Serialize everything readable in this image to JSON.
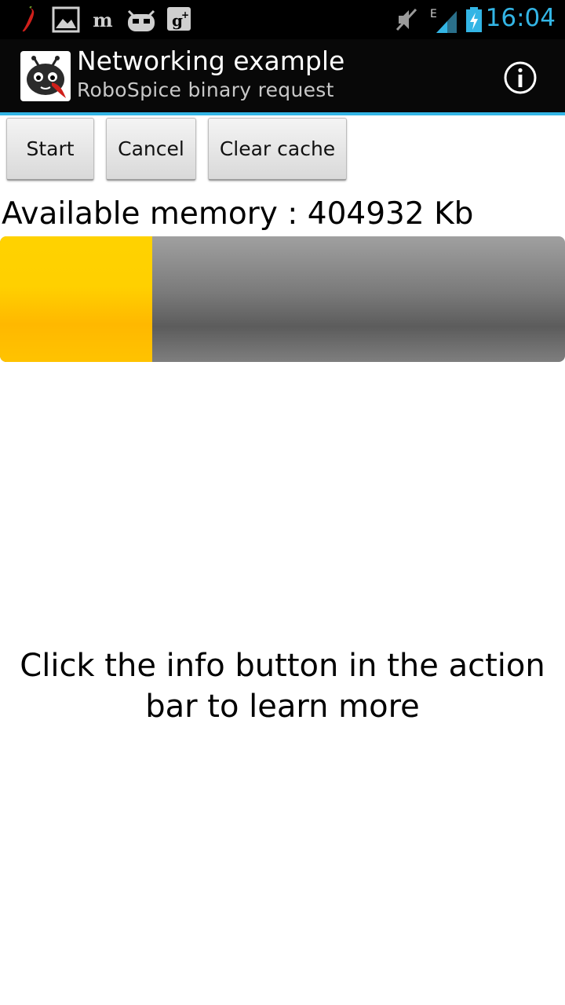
{
  "status_bar": {
    "time": "16:04",
    "network_type": "E",
    "left_icons": [
      "chili-icon",
      "image-icon",
      "newspaper-icon",
      "robot-face-icon",
      "google-plus-icon"
    ],
    "right_icons": [
      "mute-icon",
      "signal-icon",
      "battery-charging-icon"
    ],
    "accent_color": "#33b5e5"
  },
  "action_bar": {
    "title": "Networking example",
    "subtitle": "RoboSpice binary request",
    "logo_icon": "robospice-logo-icon",
    "action_icon": "info-icon"
  },
  "buttons": {
    "start": "Start",
    "cancel": "Cancel",
    "clear_cache": "Clear cache"
  },
  "memory": {
    "label": "Available memory : 404932 Kb"
  },
  "progress": {
    "fraction": 0.27,
    "fill_color": "#ffc800",
    "track_color": "#777777"
  },
  "message": {
    "text": "Click the info button in the action bar to learn more"
  }
}
